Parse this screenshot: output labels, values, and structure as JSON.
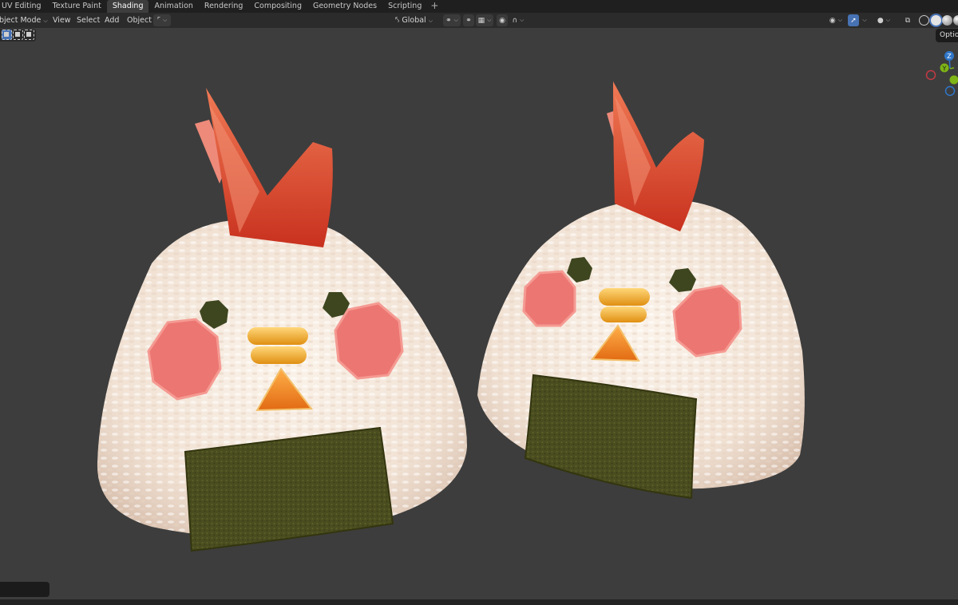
{
  "workspace_tabs": [
    "UV Editing",
    "Texture Paint",
    "Shading",
    "Animation",
    "Rendering",
    "Compositing",
    "Geometry Nodes",
    "Scripting"
  ],
  "active_tab": "Shading",
  "add_tab_icon": "plus-icon",
  "header": {
    "mode_label": "bject Mode",
    "menus": {
      "view": "View",
      "select": "Select",
      "add": "Add",
      "object": "Object"
    },
    "transform_orientation": "Global",
    "icons": [
      "object-type-icon",
      "transform-orientation-icon",
      "pivot-icon",
      "snap-icon",
      "snap-target-icon",
      "proportional-edit-icon",
      "falloff-icon",
      "visibility-icon",
      "gizmo-icon",
      "overlay-icon",
      "xray-icon",
      "wireframe-shading-icon",
      "solid-shading-icon",
      "material-shading-icon",
      "rendered-shading-icon"
    ]
  },
  "options_label": "Optio",
  "gizmo": {
    "z": "Z",
    "y": "Y"
  },
  "colors": {
    "x_axis": "#c23a45",
    "y_axis": "#7fb515",
    "z_axis": "#2f76c8",
    "active_blue": "#4772b3",
    "viewport_bg": "#3d3d3d"
  },
  "viewport_objects": [
    "rice-ball-chicken-left",
    "rice-ball-chicken-right"
  ]
}
